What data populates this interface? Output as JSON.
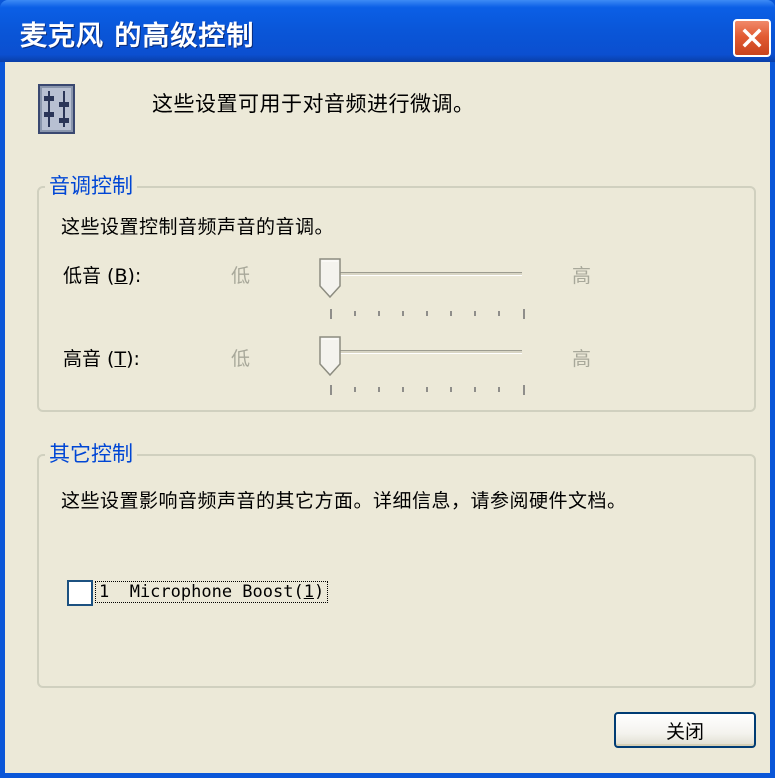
{
  "window": {
    "title": "麦克风 的高级控制"
  },
  "header": {
    "description": "这些设置可用于对音频进行微调。",
    "icon": "mixer-icon"
  },
  "tone_group": {
    "title": "音调控制",
    "description": "这些设置控制音频声音的音调。",
    "sliders": [
      {
        "label": "低音",
        "mnemonic_open": " (",
        "mnemonic": "B",
        "mnemonic_close": "):",
        "min_label": "低",
        "max_label": "高",
        "value": 0
      },
      {
        "label": "高音",
        "mnemonic_open": " (",
        "mnemonic": "T",
        "mnemonic_close": "):",
        "min_label": "低",
        "max_label": "高",
        "value": 0
      }
    ]
  },
  "other_group": {
    "title": "其它控制",
    "description": "这些设置影响音频声音的其它方面。详细信息，请参阅硬件文档。",
    "checkbox": {
      "label_prefix": "1  Microphone Boost(",
      "mnemonic": "1",
      "label_suffix": ")",
      "checked": false
    }
  },
  "buttons": {
    "close": "关闭"
  }
}
